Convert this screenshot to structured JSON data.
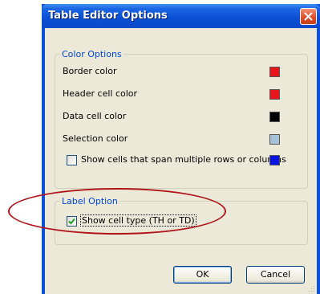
{
  "window": {
    "title": "Table Editor Options"
  },
  "color_options": {
    "legend": "Color Options",
    "rows": [
      {
        "label": "Border color",
        "swatch_color": "#e8141c",
        "icon": "color-swatch"
      },
      {
        "label": "Header cell color",
        "swatch_color": "#e8141c",
        "icon": "color-swatch"
      },
      {
        "label": "Data cell color",
        "swatch_color": "#000000",
        "icon": "color-swatch"
      },
      {
        "label": "Selection color",
        "swatch_color": "#a7c2d8",
        "icon": "color-swatch"
      }
    ],
    "span_checkbox": {
      "label": "Show cells that span multiple rows or columns",
      "checked": false,
      "swatch_color": "#0a14e0"
    }
  },
  "label_option": {
    "legend": "Label Option",
    "cell_type_checkbox": {
      "label": "Show cell type (TH or TD)",
      "checked": true
    }
  },
  "buttons": {
    "ok_label": "OK",
    "cancel_label": "Cancel"
  },
  "annotation_color": "#b0151b"
}
